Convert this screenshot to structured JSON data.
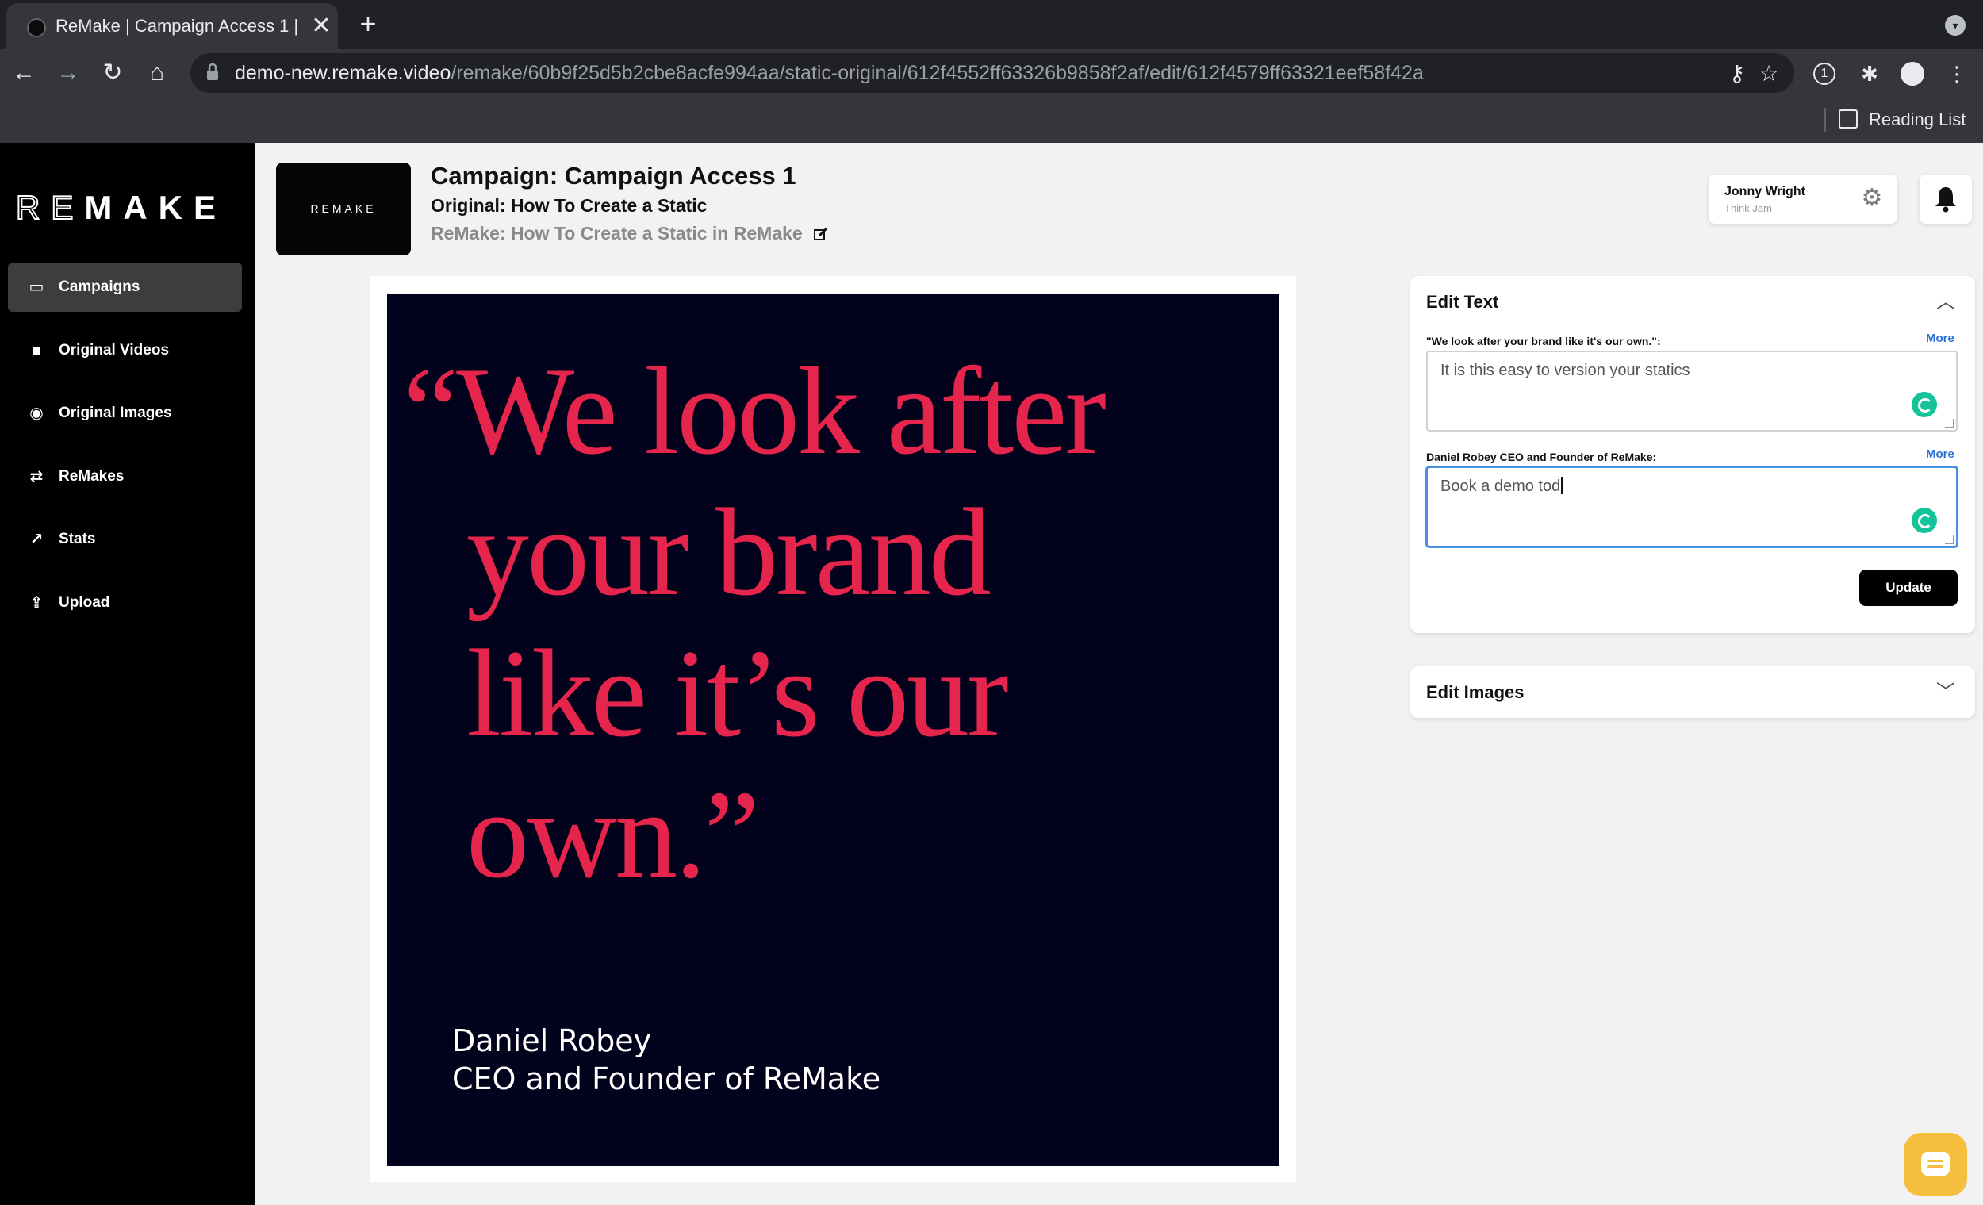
{
  "browser": {
    "tab_title": "ReMake | Campaign Access 1 |",
    "tab_close": "✕",
    "new_tab": "+",
    "url_host": "demo-new.remake.video",
    "url_path": "/remake/60b9f25d5b2cbe8acfe994aa/static-original/612f4552ff63326b9858f2af/edit/612f4579ff63321eef58f42a",
    "reading_list_label": "Reading List",
    "onepass_badge": "1"
  },
  "sidebar": {
    "logo_thin": "RE",
    "logo_bold": "MAKE",
    "items": [
      {
        "label": "Campaigns",
        "icon": "monitor-icon",
        "glyph": "▭"
      },
      {
        "label": "Original Videos",
        "icon": "video-camera-icon",
        "glyph": "■"
      },
      {
        "label": "Original Images",
        "icon": "camera-icon",
        "glyph": "◉"
      },
      {
        "label": "ReMakes",
        "icon": "repeat-icon",
        "glyph": "⇄"
      },
      {
        "label": "Stats",
        "icon": "chart-line-icon",
        "glyph": "↗"
      },
      {
        "label": "Upload",
        "icon": "upload-icon",
        "glyph": "⇪"
      }
    ]
  },
  "header": {
    "thumb_logo": "REMAKE",
    "title": "Campaign: Campaign Access 1",
    "original": "Original: How To Create a Static",
    "remake": "ReMake: How To Create a Static in ReMake"
  },
  "user": {
    "name": "Jonny Wright",
    "org": "Think Jam"
  },
  "artwork": {
    "quote_lines": [
      "“We look after",
      "your brand",
      "like it’s our",
      "own.”"
    ],
    "author_name": "Daniel Robey",
    "author_role": "CEO and Founder of ReMake",
    "quote_color": "#e5254c",
    "background_color": "#03021c"
  },
  "edit_text": {
    "title": "Edit Text",
    "more_label": "More",
    "fields": [
      {
        "label": "\"We look after your brand like it's our own.\":",
        "value": "It is this easy to version your statics"
      },
      {
        "label": "Daniel Robey CEO and Founder of ReMake:",
        "value": "Book a demo tod"
      }
    ],
    "update_label": "Update"
  },
  "edit_images": {
    "title": "Edit Images"
  }
}
